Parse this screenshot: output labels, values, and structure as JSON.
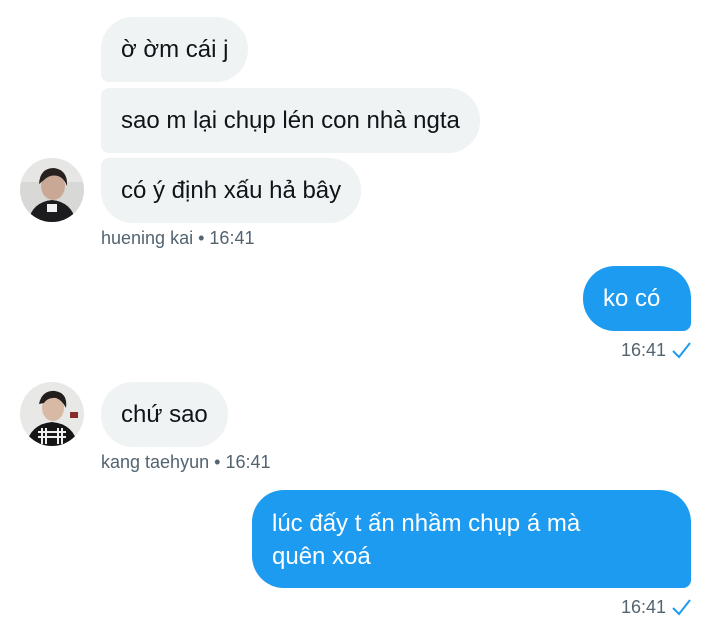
{
  "conversation": {
    "incoming_group_1": {
      "messages": [
        "ờ ờm cái j",
        "sao m lại chụp lén con nhà ngta",
        "có ý định xấu hả bây"
      ],
      "sender": "huening kai",
      "separator": "•",
      "time": "16:41"
    },
    "outgoing_1": {
      "text": "ko có",
      "time": "16:41",
      "status_icon": "check-icon"
    },
    "incoming_group_2": {
      "messages": [
        "chứ sao"
      ],
      "sender": "kang taehyun",
      "separator": "•",
      "time": "16:41"
    },
    "outgoing_2": {
      "line1": "lúc đấy t ấn nhầm chụp á mà",
      "line2": "quên xoá",
      "time": "16:41",
      "status_icon": "check-icon"
    }
  },
  "colors": {
    "incoming_bubble": "#eff3f4",
    "outgoing_bubble": "#1d9bf0",
    "meta_text": "#536471",
    "check": "#1d9bf0"
  }
}
